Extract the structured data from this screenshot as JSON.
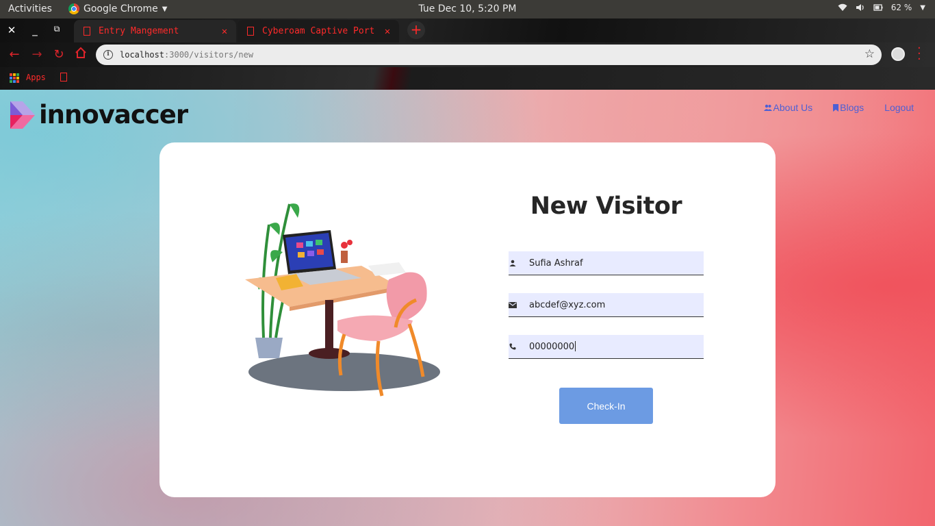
{
  "os_bar": {
    "activities": "Activities",
    "app_name": "Google Chrome",
    "clock": "Tue Dec 10,  5:20 PM",
    "battery": "62 %"
  },
  "browser": {
    "tabs": [
      {
        "title": "Entry Mangement",
        "active": true
      },
      {
        "title": "Cyberoam Captive Port",
        "active": false
      }
    ],
    "url_host": "localhost",
    "url_path": ":3000/visitors/new",
    "bookmarks": {
      "apps_label": "Apps"
    },
    "accent_color": "#ff2a2a"
  },
  "header": {
    "brand": "innovaccer",
    "nav": [
      {
        "label": "About Us",
        "icon": "group-icon"
      },
      {
        "label": "Blogs",
        "icon": "bookmark-icon"
      },
      {
        "label": "Logout",
        "icon": ""
      }
    ],
    "nav_color": "#4c5fd5"
  },
  "form": {
    "title": "New Visitor",
    "fields": [
      {
        "icon": "person-icon",
        "value": "Sufia Ashraf"
      },
      {
        "icon": "mail-icon",
        "value": "abcdef@xyz.com"
      },
      {
        "icon": "phone-icon",
        "value": "00000000"
      }
    ],
    "submit_label": "Check-In",
    "submit_color": "#6c9be3"
  }
}
